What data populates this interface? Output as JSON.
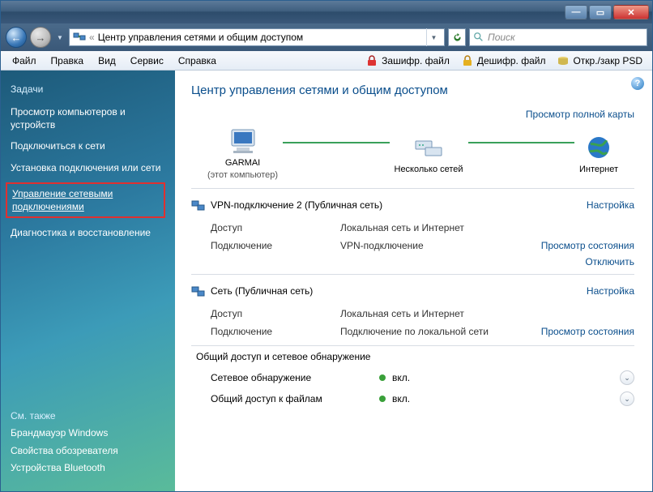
{
  "addressbar": {
    "path": "Центр управления сетями и общим доступом"
  },
  "search": {
    "placeholder": "Поиск"
  },
  "menubar": {
    "file": "Файл",
    "edit": "Правка",
    "view": "Вид",
    "tools": "Сервис",
    "help": "Справка"
  },
  "toolbar": {
    "encrypt": "Зашифр. файл",
    "decrypt": "Дешифр. файл",
    "openclose_psd": "Откр./закр PSD"
  },
  "sidebar": {
    "tasks_header": "Задачи",
    "items": [
      "Просмотр компьютеров и устройств",
      "Подключиться к сети",
      "Установка подключения или сети",
      "Управление сетевыми подключениями",
      "Диагностика и восстановление"
    ],
    "seealso_header": "См. также",
    "seealso": [
      "Брандмауэр Windows",
      "Свойства обозревателя",
      "Устройства Bluetooth"
    ]
  },
  "main": {
    "title": "Центр управления сетями и общим доступом",
    "view_full_map": "Просмотр полной карты",
    "node_computer": "GARMAI",
    "node_computer_sub": "(этот компьютер)",
    "node_networks": "Несколько сетей",
    "node_internet": "Интернет",
    "sections": [
      {
        "title": "VPN-подключение  2 (Публичная сеть)",
        "configure": "Настройка",
        "rows": [
          {
            "k": "Доступ",
            "v": "Локальная сеть и Интернет",
            "a": ""
          },
          {
            "k": "Подключение",
            "v": "VPN-подключение",
            "a": "Просмотр состояния"
          }
        ],
        "extra_action": "Отключить"
      },
      {
        "title": "Сеть (Публичная сеть)",
        "configure": "Настройка",
        "rows": [
          {
            "k": "Доступ",
            "v": "Локальная сеть и Интернет",
            "a": ""
          },
          {
            "k": "Подключение",
            "v": "Подключение по локальной сети",
            "a": "Просмотр состояния"
          }
        ]
      }
    ],
    "sharing": {
      "header": "Общий доступ и сетевое обнаружение",
      "rows": [
        {
          "label": "Сетевое обнаружение",
          "value": "вкл."
        },
        {
          "label": "Общий доступ к файлам",
          "value": "вкл."
        }
      ]
    }
  }
}
